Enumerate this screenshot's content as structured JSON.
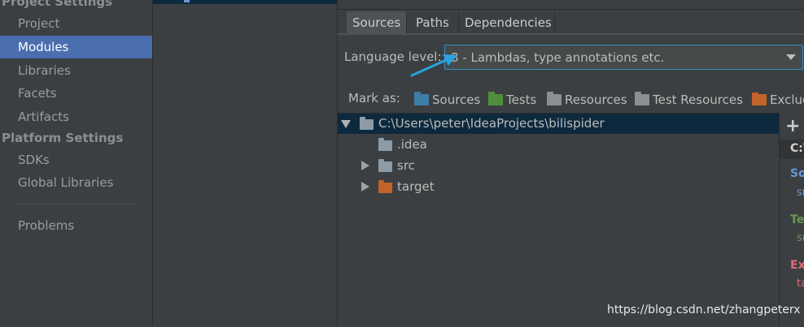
{
  "nav": {
    "project_header": "Project Settings",
    "project_items": [
      "Project",
      "Modules",
      "Libraries",
      "Facets",
      "Artifacts"
    ],
    "platform_header": "Platform Settings",
    "platform_items": [
      "SDKs",
      "Global Libraries"
    ],
    "problems": "Problems",
    "selected": "Modules"
  },
  "tabs": [
    "Sources",
    "Paths",
    "Dependencies"
  ],
  "active_tab": "Sources",
  "language_level": {
    "label": "Language level:",
    "value": "8 - Lambdas, type annotations etc."
  },
  "mark_as": {
    "label": "Mark as:",
    "buttons": [
      {
        "label": "Sources",
        "color": "#3d7ea6",
        "icon": "sources-folder-icon"
      },
      {
        "label": "Tests",
        "color": "#4f8f3a",
        "icon": "tests-folder-icon"
      },
      {
        "label": "Resources",
        "color": "#8c8f91",
        "icon": "resources-folder-icon"
      },
      {
        "label": "Test Resources",
        "color": "#8c8f91",
        "icon": "test-resources-folder-icon"
      },
      {
        "label": "Excluded",
        "color": "#c3622a",
        "icon": "excluded-folder-icon"
      }
    ]
  },
  "tree": {
    "root": "C:\\Users\\peter\\IdeaProjects\\bilispider",
    "children": [
      {
        "label": ".idea",
        "color": "#8c9ba6"
      },
      {
        "label": "src",
        "color": "#8c9ba6"
      },
      {
        "label": "target",
        "color": "#c3622a"
      }
    ]
  },
  "side": {
    "add": "+",
    "path": "C:\\",
    "sources_title": "So",
    "sources_sub": "sr",
    "tests_title": "Te",
    "tests_sub": "sr",
    "excluded_title": "Ex",
    "excluded_sub": "ta"
  },
  "colors": {
    "selection": "#4b6eaf",
    "tree_selection": "#0d293e",
    "sources": "#5a9bd5",
    "tests": "#6a9955",
    "excluded": "#e06c75",
    "annotation_arrow": "#2aa3e0"
  },
  "watermark": "https://blog.csdn.net/zhangpeterx"
}
